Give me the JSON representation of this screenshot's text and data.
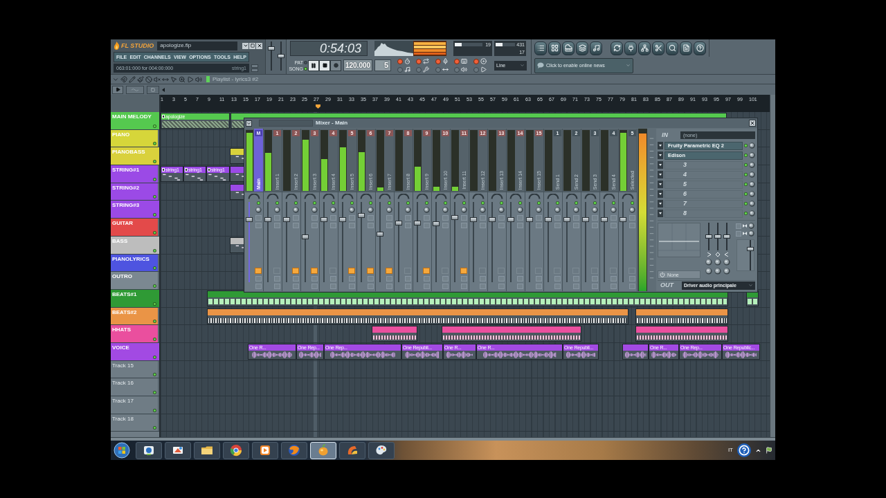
{
  "header": {
    "logo": "FL STUDIO",
    "file_name": "apologize.flp",
    "menu": [
      "FILE",
      "EDIT",
      "CHANNELS",
      "VIEW",
      "OPTIONS",
      "TOOLS",
      "HELP"
    ],
    "hint": "063:01:000 for 004:00:000",
    "hint_target": "string1"
  },
  "master_sliders": [
    {
      "level": 0.8
    },
    {
      "level": 0.5
    }
  ],
  "transport": {
    "time": "0:54:03",
    "modes": [
      {
        "label": "PAT",
        "selected": false
      },
      {
        "label": "SONG",
        "selected": true
      }
    ],
    "buttons": [
      {
        "kind": "pause"
      },
      {
        "kind": "stop"
      },
      {
        "kind": "record"
      }
    ],
    "tempo": "120.000",
    "pattern": "5"
  },
  "toggles": [
    {
      "on": true
    },
    {
      "on": true
    },
    {
      "on": true
    },
    {
      "on": true
    },
    {
      "on": true
    },
    {
      "on": false
    },
    {
      "on": false
    },
    {
      "on": false
    },
    {
      "on": false
    },
    {
      "on": false
    }
  ],
  "cpu_panels": [
    {
      "level": 0.25,
      "values": [
        "19"
      ]
    },
    {
      "level": 0.35,
      "values": [
        "431",
        "17"
      ]
    }
  ],
  "line_mode": "Line",
  "news": "Click to enable online news",
  "playlist": {
    "title": "Playlist - lyrics3 #2",
    "ruler": [
      "1",
      "3",
      "5",
      "7",
      "9",
      "11",
      "13",
      "15",
      "17",
      "19",
      "21",
      "23",
      "25",
      "27",
      "29",
      "31",
      "33",
      "35",
      "37",
      "39",
      "41",
      "43",
      "45",
      "47",
      "49",
      "51",
      "53",
      "55",
      "57",
      "59",
      "61",
      "63",
      "65",
      "67",
      "69",
      "71",
      "73",
      "75",
      "77",
      "79",
      "81",
      "83",
      "85",
      "87",
      "89",
      "91",
      "93",
      "95",
      "97",
      "99",
      "101"
    ],
    "tracks": [
      {
        "name": "MAIN MELODY",
        "color": "#55c94f",
        "marked": true,
        "dimmed": false,
        "clip_labels": [
          "apologize"
        ]
      },
      {
        "name": "PIANO",
        "color": "#d6d63a",
        "marked": false,
        "dimmed": false
      },
      {
        "name": "PIANOBASS",
        "color": "#d9d13c",
        "marked": true,
        "dimmed": false
      },
      {
        "name": "STRING#1",
        "color": "#9b4ae6",
        "marked": false,
        "dimmed": false,
        "clip_labels": [
          "string1",
          "string1",
          "string1"
        ]
      },
      {
        "name": "STRING#2",
        "color": "#9b4ae6",
        "marked": false,
        "dimmed": false
      },
      {
        "name": "STRING#3",
        "color": "#9b4ae6",
        "marked": true,
        "dimmed": false
      },
      {
        "name": "GUITAR",
        "color": "#e34a4a",
        "marked": false,
        "dimmed": false
      },
      {
        "name": "BASS",
        "color": "#bdbdbd",
        "marked": true,
        "dimmed": false
      },
      {
        "name": "PIANOLYRICS",
        "color": "#4e54e0",
        "marked": false,
        "dimmed": false
      },
      {
        "name": "OUTRO",
        "color": "#7b8891",
        "marked": false,
        "dimmed": false
      },
      {
        "name": "BEATS#1",
        "color": "#2f9a35",
        "marked": true,
        "dimmed": false
      },
      {
        "name": "BEATS#2",
        "color": "#ea9446",
        "marked": false,
        "dimmed": false
      },
      {
        "name": "HHATS",
        "color": "#ea4f9e",
        "marked": false,
        "dimmed": false
      },
      {
        "name": "VOICE",
        "color": "#a24ae3",
        "marked": true,
        "dimmed": false,
        "clip_labels": [
          "One R...",
          "One Rep...",
          "One Rep...",
          "One Republi...",
          "One R...",
          "One R...",
          "One Republi...",
          "One R...",
          "One Rep...",
          "One Republic..."
        ]
      },
      {
        "name": "Track 15",
        "color": "#6f7c85",
        "marked": false,
        "dimmed": true
      },
      {
        "name": "Track 16",
        "color": "#6f7c85",
        "marked": false,
        "dimmed": true
      },
      {
        "name": "Track 17",
        "color": "#6f7c85",
        "marked": false,
        "dimmed": true
      },
      {
        "name": "Track 18",
        "color": "#6f7c85",
        "marked": false,
        "dimmed": true
      }
    ]
  },
  "mixer": {
    "title": "Mixer - Main",
    "strips": [
      {
        "kind": "master",
        "badge": "M",
        "label": "Main",
        "selected": true,
        "meter": {
          "level": 0.95
        },
        "fader": {
          "level": 0.8
        },
        "routed": true
      },
      {
        "kind": "insert",
        "badge": "1",
        "label": "Insert 1",
        "selected": false,
        "meter": {
          "level": 0.62
        },
        "fader": {
          "level": 0.8
        },
        "routed": false
      },
      {
        "kind": "insert",
        "badge": "2",
        "label": "Insert 2",
        "selected": false,
        "fader": {
          "level": 0.8
        },
        "routed": true
      },
      {
        "kind": "insert",
        "badge": "3",
        "label": "Insert 3",
        "selected": false,
        "meter": {
          "level": 0.84
        },
        "fader": {
          "level": 0.57
        },
        "routed": true
      },
      {
        "kind": "insert",
        "badge": "4",
        "label": "Insert 4",
        "selected": false,
        "meter": {
          "level": 0.52
        },
        "fader": {
          "level": 0.8
        },
        "routed": false
      },
      {
        "kind": "insert",
        "badge": "5",
        "label": "Insert 5",
        "selected": false,
        "meter": {
          "level": 0.72
        },
        "fader": {
          "level": 0.8
        },
        "routed": true
      },
      {
        "kind": "insert",
        "badge": "6",
        "label": "Insert 6",
        "selected": false,
        "meter": {
          "level": 0.64
        },
        "fader": {
          "level": 0.85
        },
        "routed": true
      },
      {
        "kind": "insert",
        "badge": "7",
        "label": "Insert 7",
        "selected": false,
        "meter": {
          "level": 0.06
        },
        "fader": {
          "level": 0.61
        },
        "routed": true
      },
      {
        "kind": "insert",
        "badge": "8",
        "label": "Insert 8",
        "selected": false,
        "fader": {
          "level": 0.75
        },
        "routed": false
      },
      {
        "kind": "insert",
        "badge": "9",
        "label": "Insert 9",
        "selected": false,
        "meter": {
          "level": 0.4
        },
        "fader": {
          "level": 0.75
        },
        "routed": true
      },
      {
        "kind": "insert",
        "badge": "10",
        "label": "Insert 10",
        "selected": false,
        "meter": {
          "level": 0.07
        },
        "fader": {
          "level": 0.74
        },
        "routed": false
      },
      {
        "kind": "insert",
        "badge": "11",
        "label": "Insert 11",
        "selected": false,
        "meter": {
          "level": 0.07
        },
        "fader": {
          "level": 0.83
        },
        "routed": true
      },
      {
        "kind": "insert",
        "badge": "12",
        "label": "Insert 12",
        "selected": false,
        "fader": {
          "level": 0.8
        },
        "routed": false
      },
      {
        "kind": "insert",
        "badge": "13",
        "label": "Insert 13",
        "selected": false,
        "fader": {
          "level": 0.8
        },
        "routed": false
      },
      {
        "kind": "insert",
        "badge": "14",
        "label": "Insert 14",
        "selected": false,
        "fader": {
          "level": 0.8
        },
        "routed": false
      },
      {
        "kind": "insert",
        "badge": "15",
        "label": "Insert 15",
        "selected": false,
        "fader": {
          "level": 0.8
        },
        "routed": false
      },
      {
        "kind": "send",
        "badge": "1",
        "label": "Send 1",
        "selected": false,
        "fader": {
          "level": 0.8
        },
        "routed": false
      },
      {
        "kind": "send",
        "badge": "2",
        "label": "Send 2",
        "selected": false,
        "fader": {
          "level": 0.8
        },
        "routed": false
      },
      {
        "kind": "send",
        "badge": "3",
        "label": "Send 3",
        "selected": false,
        "fader": {
          "level": 0.8
        },
        "routed": false
      },
      {
        "kind": "send",
        "badge": "4",
        "label": "Send 4",
        "selected": false,
        "fader": {
          "level": 0.8
        },
        "routed": false
      },
      {
        "kind": "selected",
        "badge": "5",
        "label": "Selected",
        "selected": false,
        "meter": {
          "level": 0.95
        },
        "fader": {
          "level": 0.8
        },
        "routed": false
      }
    ],
    "master_meter": {
      "level": 0.97
    },
    "input_label": "IN",
    "input": "(none)",
    "slots": [
      {
        "kind": "effect",
        "name": "Fruity Parametric EQ 2"
      },
      {
        "kind": "effect",
        "name": "Edison"
      },
      {
        "kind": "empty",
        "name": "3"
      },
      {
        "kind": "empty",
        "name": "4"
      },
      {
        "kind": "empty",
        "name": "5"
      },
      {
        "kind": "empty",
        "name": "6"
      },
      {
        "kind": "empty",
        "name": "7"
      },
      {
        "kind": "empty",
        "name": "8"
      }
    ],
    "eq_bands": [
      {
        "level": 0.5
      },
      {
        "level": 0.5
      },
      {
        "level": 0.5
      }
    ],
    "side_slider": {
      "level": 0.75
    },
    "preset": "None",
    "output_label": "OUT",
    "output": "Driver audio principale"
  },
  "taskbar": {
    "apps": [
      {
        "selected": false
      },
      {
        "selected": false
      },
      {
        "selected": false
      },
      {
        "selected": false
      },
      {
        "selected": false
      },
      {
        "selected": false
      },
      {
        "selected": true
      },
      {
        "selected": false
      },
      {
        "selected": false
      }
    ],
    "language": "IT"
  }
}
